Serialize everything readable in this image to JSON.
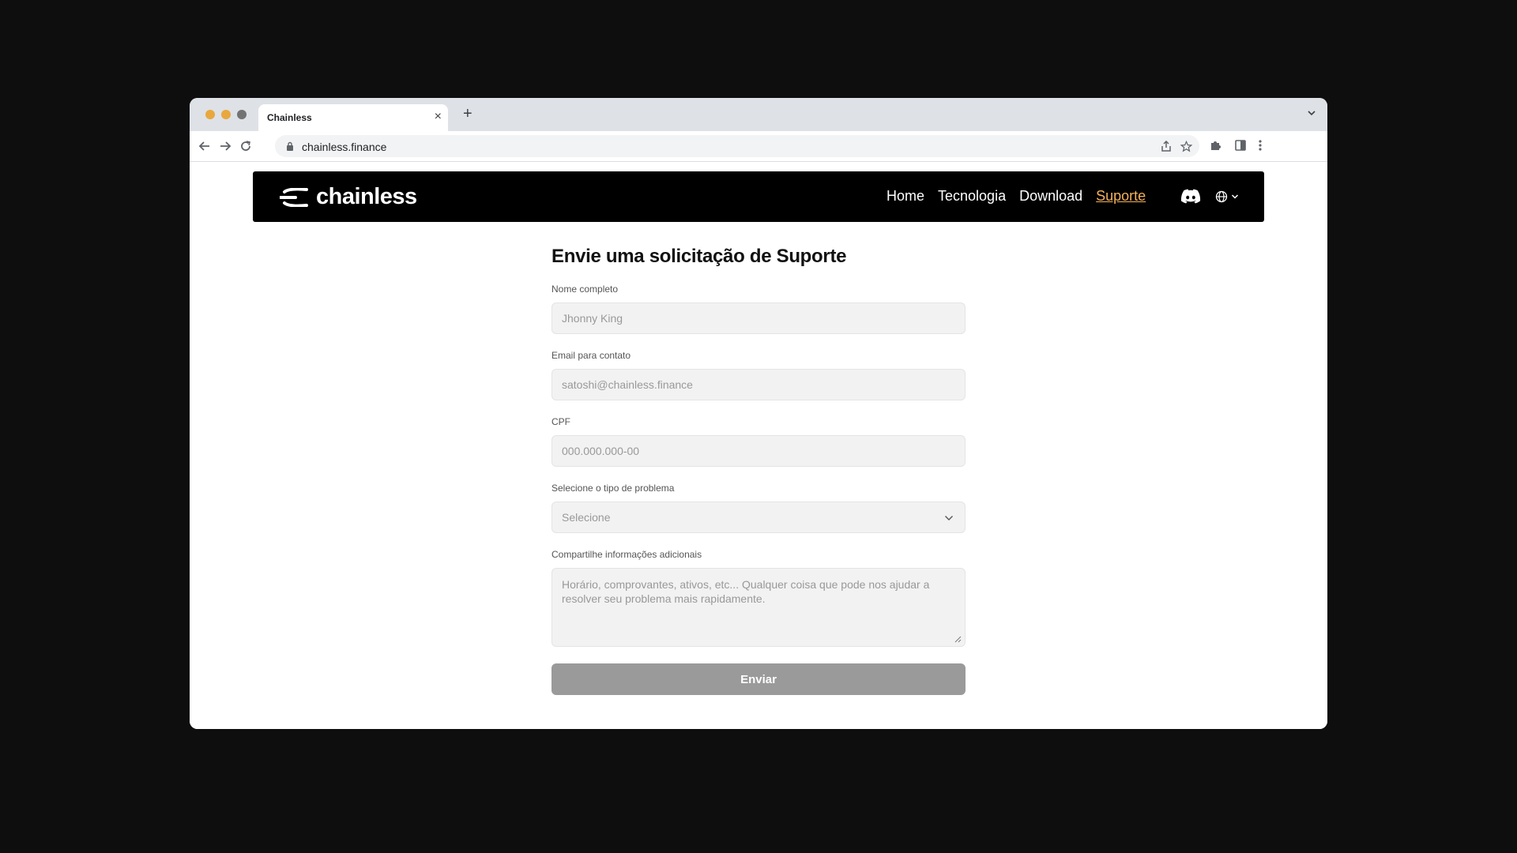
{
  "browser": {
    "tab_title": "Chainless",
    "tab_close": "×",
    "new_tab": "+",
    "url": "chainless.finance",
    "traffic_lights": [
      "#e8a83d",
      "#e8a83d",
      "#737373"
    ]
  },
  "site": {
    "logo_text": "chainless",
    "nav": [
      "Home",
      "Tecnologia",
      "Download",
      "Suporte"
    ],
    "active_nav": "Suporte",
    "accent_color": "#f5b15b",
    "icons": [
      "discord-icon",
      "globe-icon",
      "chevron-down-icon"
    ]
  },
  "form": {
    "title": "Envie uma solicitação de Suporte",
    "name_label": "Nome completo",
    "name_placeholder": "Jhonny King",
    "email_label": "Email para contato",
    "email_placeholder": "satoshi@chainless.finance",
    "cpf_label": "CPF",
    "cpf_placeholder": "000.000.000-00",
    "problem_label": "Selecione o tipo de problema",
    "problem_value": "Selecione",
    "info_label": "Compartilhe informações adicionais",
    "info_placeholder": "Horário, comprovantes, ativos, etc... Qualquer coisa que pode nos ajudar a resolver seu problema mais rapidamente.",
    "submit_label": "Enviar"
  }
}
